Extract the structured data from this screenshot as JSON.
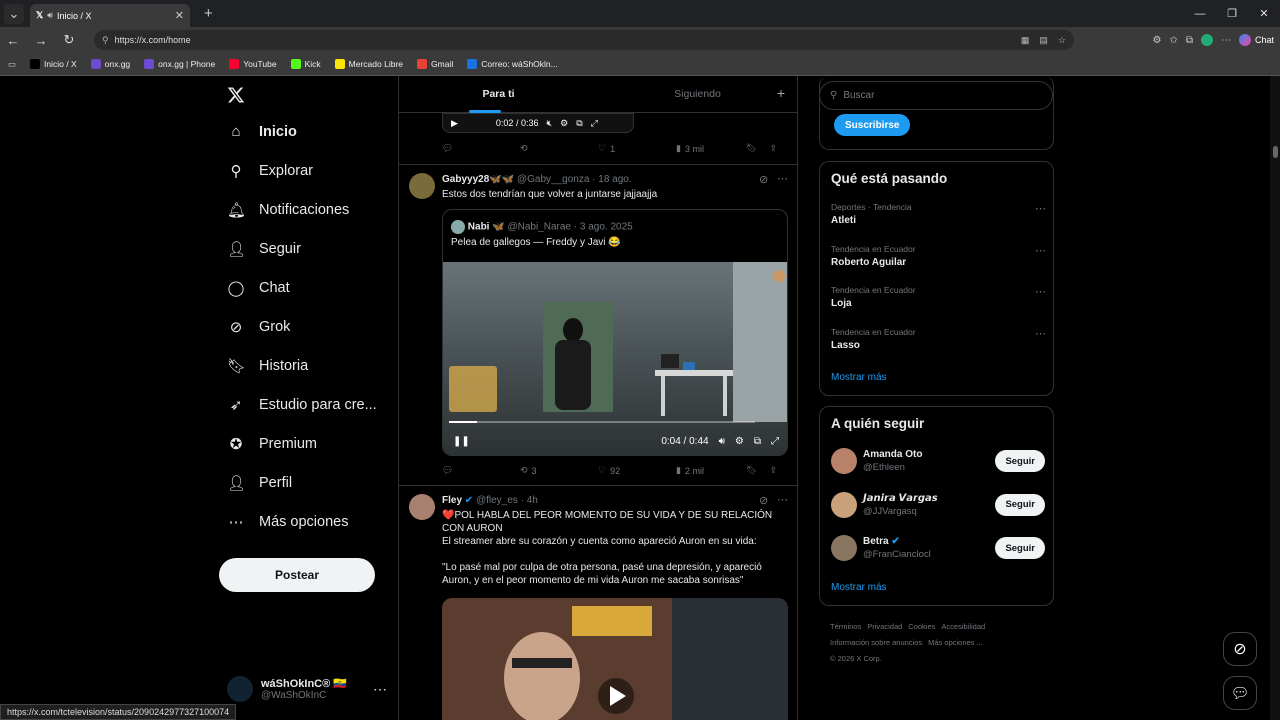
{
  "browser": {
    "tab_title": "Inicio / X",
    "url": "https://x.com/home",
    "chat_label": "Chat",
    "bookmarks": [
      {
        "label": "Inicio / X",
        "color": "#000000"
      },
      {
        "label": "onx.gg",
        "color": "#6c4bd1"
      },
      {
        "label": "onx.gg | Phone",
        "color": "#6c4bd1"
      },
      {
        "label": "YouTube",
        "color": "#ff0033"
      },
      {
        "label": "Kick",
        "color": "#53fc18"
      },
      {
        "label": "Mercado Libre",
        "color": "#ffe600"
      },
      {
        "label": "Gmail",
        "color": "#ea4335"
      },
      {
        "label": "Correo: wáShOkln...",
        "color": "#1a73e8"
      }
    ]
  },
  "nav": {
    "items": [
      {
        "label": "Inicio",
        "icon": "home-icon"
      },
      {
        "label": "Explorar",
        "icon": "search-icon"
      },
      {
        "label": "Notificaciones",
        "icon": "bell-icon"
      },
      {
        "label": "Seguir",
        "icon": "person-add-icon"
      },
      {
        "label": "Chat",
        "icon": "chat-icon"
      },
      {
        "label": "Grok",
        "icon": "grok-icon"
      },
      {
        "label": "Historia",
        "icon": "bookmark-icon"
      },
      {
        "label": "Estudio para cre...",
        "icon": "rocket-icon"
      },
      {
        "label": "Premium",
        "icon": "verified-icon"
      },
      {
        "label": "Perfil",
        "icon": "user-icon"
      },
      {
        "label": "Más opciones",
        "icon": "more-circle-icon"
      }
    ],
    "post_label": "Postear",
    "account": {
      "name": "wáShOkInC® 🇪🇨",
      "handle": "@WaShOkInC"
    }
  },
  "timeline": {
    "tabs": [
      "Para ti",
      "Siguiendo"
    ],
    "top_video": {
      "time": "0:02 / 0:36"
    },
    "top_actions": {
      "likes": "1",
      "views": "3 mil"
    },
    "tweet1": {
      "name": "Gabyyy28🦋🦋",
      "handle": "@Gaby__gonza",
      "date": "· 18 ago.",
      "text": "Estos dos tendrían que volver a juntarse jajjaajja",
      "quote": {
        "name": "Nabi 🦋",
        "handle": "@Nabi_Narae",
        "date": "· 3 ago. 2025",
        "text": "Pelea de gallegos — Freddy y Javi 😂"
      },
      "video": {
        "time": "0:04 / 0:44",
        "progress": 0.09
      },
      "actions": {
        "reposts": "3",
        "likes": "92",
        "views": "2 mil"
      }
    },
    "tweet2": {
      "name": "Fley",
      "handle": "@fley_es",
      "date": "· 4h",
      "line1": "❤️POL HABLA DEL PEOR MOMENTO DE SU VIDA Y DE SU RELACIÓN CON AURON",
      "line2": "El streamer abre su corazón y cuenta como apareció Auron en su vida:",
      "line3": "\"Lo pasé mal por culpa de otra persona, pasé una depresión, y apareció Auron, y en el peor momento de mi vida Auron me sacaba sonrisas\""
    }
  },
  "right": {
    "search_placeholder": "Buscar",
    "subscribe_label": "Suscribirse",
    "trends_title": "Qué está pasando",
    "trends": [
      {
        "context": "Deportes · Tendencia",
        "name": "Atleti"
      },
      {
        "context": "Tendencia en Ecuador",
        "name": "Roberto Aguilar"
      },
      {
        "context": "Tendencia en Ecuador",
        "name": "Loja"
      },
      {
        "context": "Tendencia en Ecuador",
        "name": "Lasso"
      }
    ],
    "show_more": "Mostrar más",
    "follow_title": "A quién seguir",
    "follow": [
      {
        "name": "Amanda Oto",
        "handle": "@Ethleen",
        "button": "Seguir",
        "color": "#b8826a"
      },
      {
        "name": "𝙅𝙖𝙣𝙞𝙧𝙖 𝙑𝙖𝙧𝙜𝙖𝙨",
        "handle": "@JJVargasq",
        "button": "Seguir",
        "color": "#c9a27c"
      },
      {
        "name": "Betra",
        "handle": "@FranCianclocl",
        "button": "Seguir",
        "color": "#8a7560"
      }
    ],
    "footer": [
      "Términos",
      "Privacidad",
      "Cookies",
      "Accesibilidad",
      "Información sobre anuncios",
      "Más opciones ...",
      "© 2026 X Corp."
    ]
  },
  "status_url": "https://x.com/tctelevision/status/2090242977327100074"
}
